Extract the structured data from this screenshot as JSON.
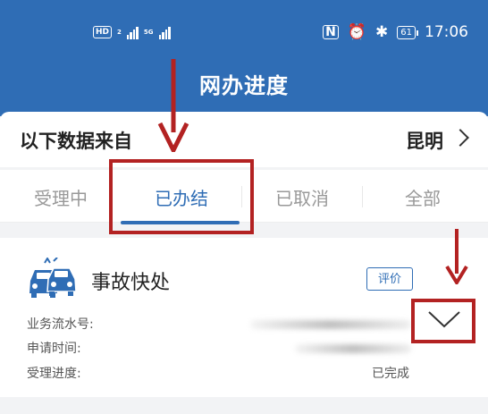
{
  "status_bar": {
    "hd_badge": "HD",
    "sim_number": "2",
    "network_type": "5G",
    "battery_level": "61",
    "time": "17:06"
  },
  "header": {
    "title": "网办进度"
  },
  "data_source": {
    "label": "以下数据来自",
    "city": "昆明"
  },
  "tabs": [
    {
      "label": "受理中"
    },
    {
      "label": "已办结"
    },
    {
      "label": "已取消"
    },
    {
      "label": "全部"
    }
  ],
  "active_tab": 1,
  "card": {
    "title": "事故快处",
    "evaluate_label": "评价",
    "fields": [
      {
        "label": "业务流水号:"
      },
      {
        "label": "申请时间:"
      },
      {
        "label": "受理进度:",
        "value": "已完成"
      }
    ]
  },
  "colors": {
    "brand_blue": "#2f6db5",
    "annotation_red": "#b32222"
  }
}
